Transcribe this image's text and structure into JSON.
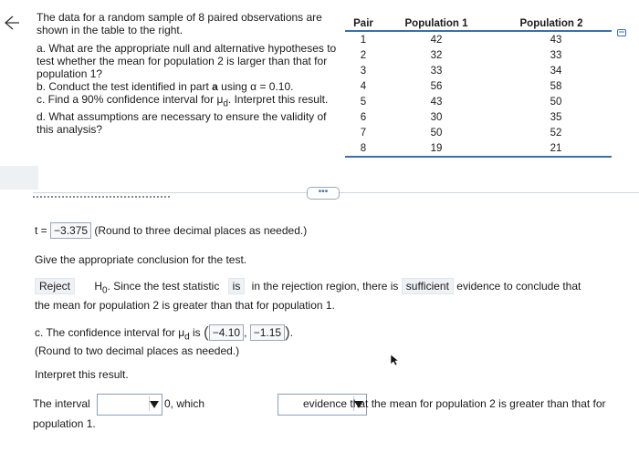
{
  "problem": {
    "intro": "The data for a random sample of 8 paired observations are shown in the table to the right.",
    "part_a": "a. What are the appropriate null and alternative hypotheses to test whether the mean for population 2 is larger than that for population 1?",
    "part_b_prefix": "b. Conduct the test identified in part ",
    "part_b_bold": "a",
    "part_b_suffix": " using α = 0.10.",
    "part_c_prefix": "c. Find a 90% confidence interval for μ",
    "part_c_sub": "d",
    "part_c_suffix": ". Interpret this result.",
    "part_d": "d. What assumptions are necessary to ensure the validity of this analysis?"
  },
  "table": {
    "headers": [
      "Pair",
      "Population 1",
      "Population 2"
    ],
    "rows": [
      [
        "1",
        "42",
        "43"
      ],
      [
        "2",
        "32",
        "33"
      ],
      [
        "3",
        "33",
        "34"
      ],
      [
        "4",
        "56",
        "58"
      ],
      [
        "5",
        "43",
        "50"
      ],
      [
        "6",
        "30",
        "35"
      ],
      [
        "7",
        "50",
        "52"
      ],
      [
        "8",
        "19",
        "21"
      ]
    ]
  },
  "divider": {
    "ellipsis": "•••"
  },
  "t_line": {
    "prefix": "t = ",
    "value": "−3.375",
    "note": " (Round to three decimal places as needed.)"
  },
  "conclusion": {
    "prompt": "Give the appropriate conclusion for the test.",
    "reject": "Reject",
    "h0": "H",
    "h0_sub": "0",
    "since": ". Since the test statistic",
    "is": "is",
    "rejection": "in the rejection region, there is",
    "sufficient": "sufficient",
    "evidence": "evidence to conclude that",
    "line2": "the mean for population 2 is greater than that for population 1."
  },
  "ci": {
    "prefix": "c. The confidence interval for μ",
    "sub": "d",
    "is": " is ",
    "lower": "−4.10",
    "upper": "−1.15",
    "round_note": "(Round to two decimal places as needed.)",
    "interpret": "Interpret this result."
  },
  "interval": {
    "the_interval": "The interval",
    "which": "0, which",
    "evidence": "evidence that the mean for population 2 is greater than that for",
    "population": "population 1."
  }
}
